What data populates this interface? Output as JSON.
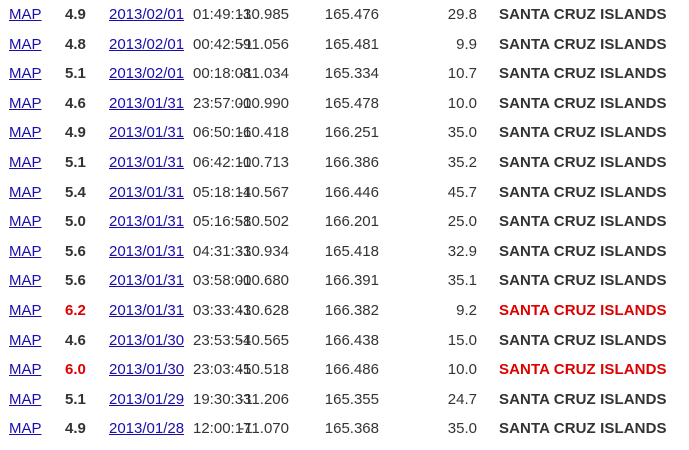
{
  "colors": {
    "link": "#1a0dab",
    "text": "#333333",
    "highlight": "#dd0000"
  },
  "rows": [
    {
      "map": "MAP",
      "mag": "4.9",
      "date": "2013/02/01",
      "time": "01:49:13",
      "lat": "-10.985",
      "lon": "165.476",
      "depth": "29.8",
      "region": "SANTA CRUZ ISLANDS",
      "highlight": false
    },
    {
      "map": "MAP",
      "mag": "4.8",
      "date": "2013/02/01",
      "time": "00:42:59",
      "lat": "-11.056",
      "lon": "165.481",
      "depth": "9.9",
      "region": "SANTA CRUZ ISLANDS",
      "highlight": false
    },
    {
      "map": "MAP",
      "mag": "5.1",
      "date": "2013/02/01",
      "time": "00:18:08",
      "lat": "-11.034",
      "lon": "165.334",
      "depth": "10.7",
      "region": "SANTA CRUZ ISLANDS",
      "highlight": false
    },
    {
      "map": "MAP",
      "mag": "4.6",
      "date": "2013/01/31",
      "time": "23:57:00",
      "lat": "-10.990",
      "lon": "165.478",
      "depth": "10.0",
      "region": "SANTA CRUZ ISLANDS",
      "highlight": false
    },
    {
      "map": "MAP",
      "mag": "4.9",
      "date": "2013/01/31",
      "time": "06:50:16",
      "lat": "-10.418",
      "lon": "166.251",
      "depth": "35.0",
      "region": "SANTA CRUZ ISLANDS",
      "highlight": false
    },
    {
      "map": "MAP",
      "mag": "5.1",
      "date": "2013/01/31",
      "time": "06:42:10",
      "lat": "-10.713",
      "lon": "166.386",
      "depth": "35.2",
      "region": "SANTA CRUZ ISLANDS",
      "highlight": false
    },
    {
      "map": "MAP",
      "mag": "5.4",
      "date": "2013/01/31",
      "time": "05:18:14",
      "lat": "-10.567",
      "lon": "166.446",
      "depth": "45.7",
      "region": "SANTA CRUZ ISLANDS",
      "highlight": false
    },
    {
      "map": "MAP",
      "mag": "5.0",
      "date": "2013/01/31",
      "time": "05:16:58",
      "lat": "-10.502",
      "lon": "166.201",
      "depth": "25.0",
      "region": "SANTA CRUZ ISLANDS",
      "highlight": false
    },
    {
      "map": "MAP",
      "mag": "5.6",
      "date": "2013/01/31",
      "time": "04:31:33",
      "lat": "-10.934",
      "lon": "165.418",
      "depth": "32.9",
      "region": "SANTA CRUZ ISLANDS",
      "highlight": false
    },
    {
      "map": "MAP",
      "mag": "5.6",
      "date": "2013/01/31",
      "time": "03:58:00",
      "lat": "-10.680",
      "lon": "166.391",
      "depth": "35.1",
      "region": "SANTA CRUZ ISLANDS",
      "highlight": false
    },
    {
      "map": "MAP",
      "mag": "6.2",
      "date": "2013/01/31",
      "time": "03:33:43",
      "lat": "-10.628",
      "lon": "166.382",
      "depth": "9.2",
      "region": "SANTA CRUZ ISLANDS",
      "highlight": true
    },
    {
      "map": "MAP",
      "mag": "4.6",
      "date": "2013/01/30",
      "time": "23:53:54",
      "lat": "-10.565",
      "lon": "166.438",
      "depth": "15.0",
      "region": "SANTA CRUZ ISLANDS",
      "highlight": false
    },
    {
      "map": "MAP",
      "mag": "6.0",
      "date": "2013/01/30",
      "time": "23:03:45",
      "lat": "-10.518",
      "lon": "166.486",
      "depth": "10.0",
      "region": "SANTA CRUZ ISLANDS",
      "highlight": true
    },
    {
      "map": "MAP",
      "mag": "5.1",
      "date": "2013/01/29",
      "time": "19:30:33",
      "lat": "-11.206",
      "lon": "165.355",
      "depth": "24.7",
      "region": "SANTA CRUZ ISLANDS",
      "highlight": false
    },
    {
      "map": "MAP",
      "mag": "4.9",
      "date": "2013/01/28",
      "time": "12:00:17",
      "lat": "-11.070",
      "lon": "165.368",
      "depth": "35.0",
      "region": "SANTA CRUZ ISLANDS",
      "highlight": false
    }
  ]
}
